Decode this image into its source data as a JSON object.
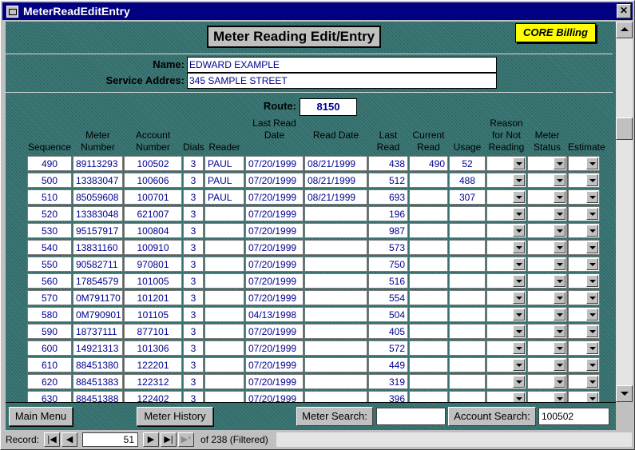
{
  "window": {
    "title": "MeterReadEditEntry",
    "close_glyph": "✕"
  },
  "form": {
    "heading": "Meter Reading Edit/Entry",
    "badge": "CORE Billing",
    "name_label": "Name:",
    "name_value": "EDWARD EXAMPLE",
    "address_label": "Service Addres:",
    "address_value": "345 SAMPLE STREET",
    "route_label": "Route:",
    "route_value": "8150"
  },
  "columns": [
    {
      "key": "seq",
      "label": "Sequence"
    },
    {
      "key": "meter",
      "label": "Meter Number"
    },
    {
      "key": "account",
      "label": "Account Number"
    },
    {
      "key": "dials",
      "label": "Dials"
    },
    {
      "key": "reader",
      "label": "Reader"
    },
    {
      "key": "last_date",
      "label": "Last Read Date"
    },
    {
      "key": "read_date",
      "label": "Read Date"
    },
    {
      "key": "last_read",
      "label": "Last Read"
    },
    {
      "key": "current",
      "label": "Current Read"
    },
    {
      "key": "usage",
      "label": "Usage"
    },
    {
      "key": "reason",
      "label": "Reason for Not Reading"
    },
    {
      "key": "status",
      "label": "Meter Status"
    },
    {
      "key": "estimate",
      "label": "Estimate"
    }
  ],
  "rows": [
    {
      "seq": "490",
      "meter": "89113293",
      "account": "100502",
      "dials": "3",
      "reader": "PAUL",
      "last_date": "07/20/1999",
      "read_date": "08/21/1999",
      "last_read": "438",
      "current": "490",
      "usage": "52"
    },
    {
      "seq": "500",
      "meter": "13383047",
      "account": "100606",
      "dials": "3",
      "reader": "PAUL",
      "last_date": "07/20/1999",
      "read_date": "08/21/1999",
      "last_read": "512",
      "current": "",
      "usage": "488"
    },
    {
      "seq": "510",
      "meter": "85059608",
      "account": "100701",
      "dials": "3",
      "reader": "PAUL",
      "last_date": "07/20/1999",
      "read_date": "08/21/1999",
      "last_read": "693",
      "current": "",
      "usage": "307"
    },
    {
      "seq": "520",
      "meter": "13383048",
      "account": "621007",
      "dials": "3",
      "reader": "",
      "last_date": "07/20/1999",
      "read_date": "",
      "last_read": "196",
      "current": "",
      "usage": ""
    },
    {
      "seq": "530",
      "meter": "95157917",
      "account": "100804",
      "dials": "3",
      "reader": "",
      "last_date": "07/20/1999",
      "read_date": "",
      "last_read": "987",
      "current": "",
      "usage": ""
    },
    {
      "seq": "540",
      "meter": "13831160",
      "account": "100910",
      "dials": "3",
      "reader": "",
      "last_date": "07/20/1999",
      "read_date": "",
      "last_read": "573",
      "current": "",
      "usage": ""
    },
    {
      "seq": "550",
      "meter": "90582711",
      "account": "970801",
      "dials": "3",
      "reader": "",
      "last_date": "07/20/1999",
      "read_date": "",
      "last_read": "750",
      "current": "",
      "usage": ""
    },
    {
      "seq": "560",
      "meter": "17854579",
      "account": "101005",
      "dials": "3",
      "reader": "",
      "last_date": "07/20/1999",
      "read_date": "",
      "last_read": "516",
      "current": "",
      "usage": ""
    },
    {
      "seq": "570",
      "meter": "0M791170",
      "account": "101201",
      "dials": "3",
      "reader": "",
      "last_date": "07/20/1999",
      "read_date": "",
      "last_read": "554",
      "current": "",
      "usage": ""
    },
    {
      "seq": "580",
      "meter": "0M790901",
      "account": "101105",
      "dials": "3",
      "reader": "",
      "last_date": "04/13/1998",
      "read_date": "",
      "last_read": "504",
      "current": "",
      "usage": ""
    },
    {
      "seq": "590",
      "meter": "18737111",
      "account": "877101",
      "dials": "3",
      "reader": "",
      "last_date": "07/20/1999",
      "read_date": "",
      "last_read": "405",
      "current": "",
      "usage": ""
    },
    {
      "seq": "600",
      "meter": "14921313",
      "account": "101306",
      "dials": "3",
      "reader": "",
      "last_date": "07/20/1999",
      "read_date": "",
      "last_read": "572",
      "current": "",
      "usage": ""
    },
    {
      "seq": "610",
      "meter": "88451380",
      "account": "122201",
      "dials": "3",
      "reader": "",
      "last_date": "07/20/1999",
      "read_date": "",
      "last_read": "449",
      "current": "",
      "usage": ""
    },
    {
      "seq": "620",
      "meter": "88451383",
      "account": "122312",
      "dials": "3",
      "reader": "",
      "last_date": "07/20/1999",
      "read_date": "",
      "last_read": "319",
      "current": "",
      "usage": ""
    },
    {
      "seq": "630",
      "meter": "88451388",
      "account": "122402",
      "dials": "3",
      "reader": "",
      "last_date": "07/20/1999",
      "read_date": "",
      "last_read": "396",
      "current": "",
      "usage": ""
    }
  ],
  "buttons": {
    "main_menu": "Main Menu",
    "meter_history": "Meter  History",
    "meter_search": "Meter Search:",
    "meter_search_value": "",
    "account_search": "Account Search:",
    "account_search_value": "100502"
  },
  "navigation": {
    "record_label": "Record:",
    "current_record": "51",
    "total_text": "of 238 (Filtered)",
    "first_glyph": "|◀",
    "prev_glyph": "◀",
    "next_glyph": "▶",
    "last_glyph": "▶|",
    "new_glyph": "▶*"
  }
}
